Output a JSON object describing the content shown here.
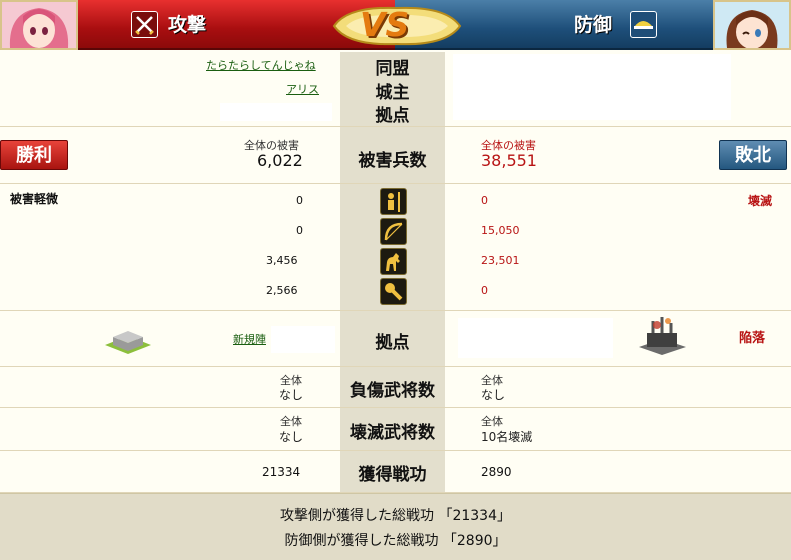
{
  "header": {
    "attack_label": "攻撃",
    "defense_label": "防御",
    "vs_label": "VS",
    "attack_icon": "crossed-swords-icon",
    "defense_icon": "shield-helmet-icon",
    "accent_attack": "#c0181a",
    "accent_defense": "#2a5f8c"
  },
  "info": {
    "alliance_label": "同盟",
    "lord_label": "城主",
    "base_label": "拠点",
    "attacker_alliance": "たらたらしてんじゃね",
    "attacker_lord": "アリス"
  },
  "damage": {
    "label": "被害兵数",
    "att_total_label": "全体の被害",
    "att_total": "6,022",
    "def_total_label": "全体の被害",
    "def_total": "38,551",
    "att_result": "勝利",
    "def_result": "敗北",
    "att_status": "被害軽微",
    "def_status": "壊滅"
  },
  "units": [
    {
      "icon": "spearman-icon",
      "att": "0",
      "def": "0"
    },
    {
      "icon": "bow-icon",
      "att": "0",
      "def": "15,050"
    },
    {
      "icon": "horse-icon",
      "att": "3,456",
      "def": "23,501"
    },
    {
      "icon": "siege-weapon-icon",
      "att": "2,566",
      "def": "0"
    }
  ],
  "base": {
    "label": "拠点",
    "att_base_link": "新規陣",
    "def_status": "陥落"
  },
  "wounded": {
    "label": "負傷武将数",
    "att_total_label": "全体",
    "att_value": "なし",
    "def_total_label": "全体",
    "def_value": "なし"
  },
  "destroyed": {
    "label": "壊滅武将数",
    "att_total_label": "全体",
    "att_value": "なし",
    "def_total_label": "全体",
    "def_value": "10名壊滅"
  },
  "merit": {
    "label": "獲得戦功",
    "att_value": "21334",
    "def_value": "2890"
  },
  "footer": {
    "line1": "攻撃側が獲得した総戦功 「21334」",
    "line2": "防御側が獲得した総戦功 「2890」"
  }
}
